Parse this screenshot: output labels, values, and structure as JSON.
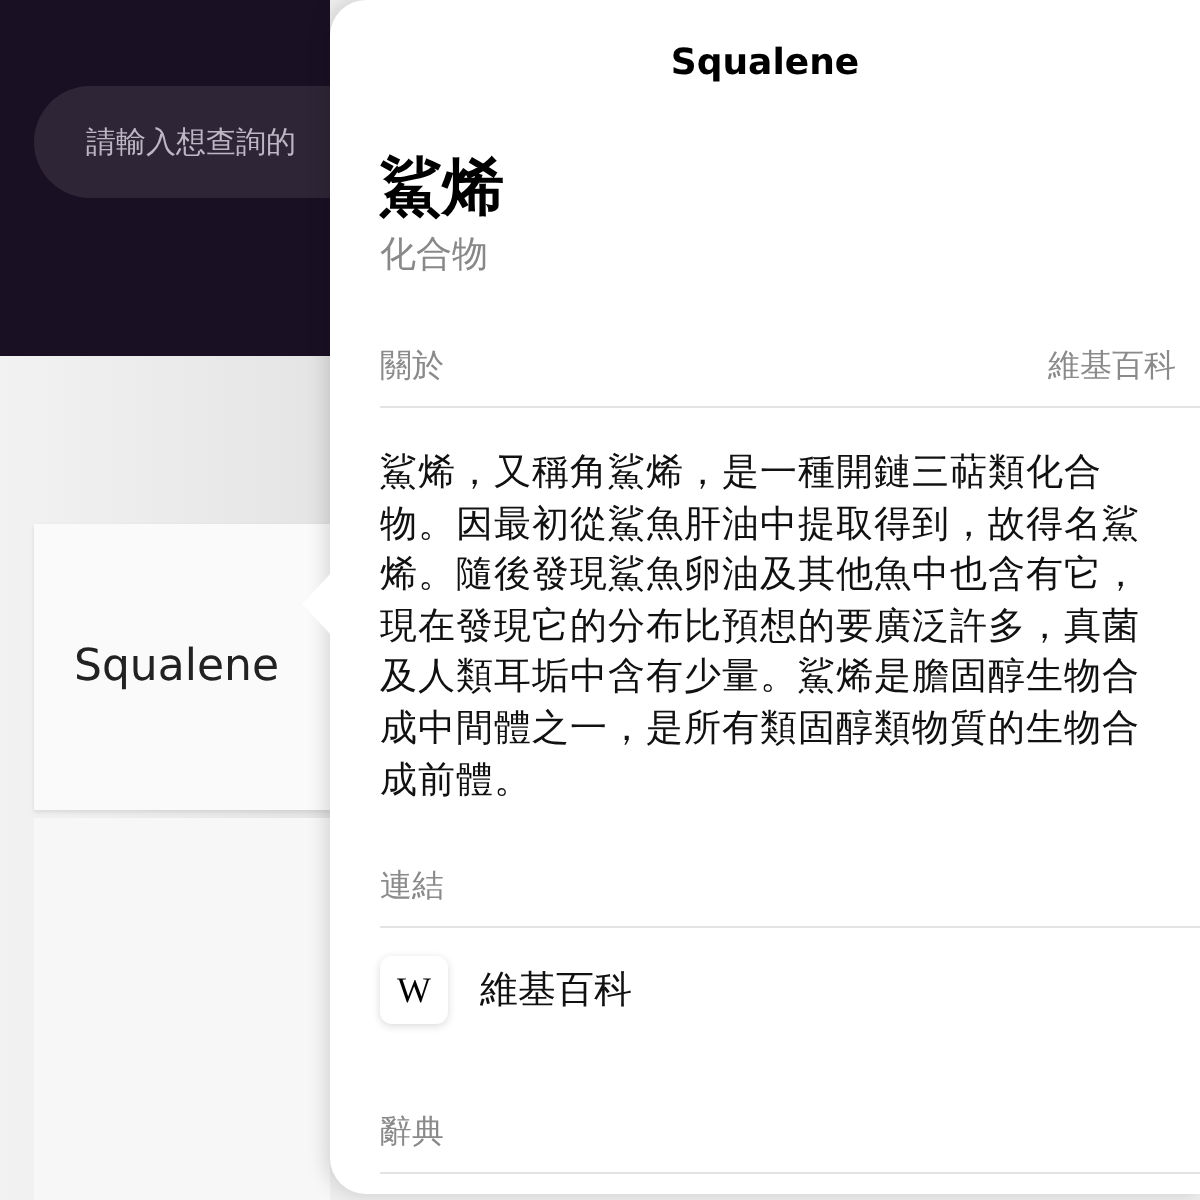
{
  "search": {
    "placeholder": "請輸入想查詢的"
  },
  "result_card": {
    "label": "Squalene"
  },
  "popover": {
    "title": "Squalene",
    "heading": "鯊烯",
    "subtitle": "化合物",
    "sections": [
      {
        "kind": "text",
        "header": "關於",
        "source": "維基百科",
        "body": "鯊烯，又稱角鯊烯，是一種開鏈三萜類化合物。因最初從鯊魚肝油中提取得到，故得名鯊烯。隨後發現鯊魚卵油及其他魚中也含有它，現在發現它的分布比預想的要廣泛許多，真菌及人類耳垢中含有少量。鯊烯是膽固醇生物合成中間體之一，是所有類固醇類物質的生物合成前體。"
      },
      {
        "kind": "links",
        "header": "連結",
        "links": [
          {
            "icon_letter": "W",
            "label": "維基百科"
          }
        ]
      },
      {
        "kind": "header",
        "header": "辭典"
      }
    ]
  }
}
